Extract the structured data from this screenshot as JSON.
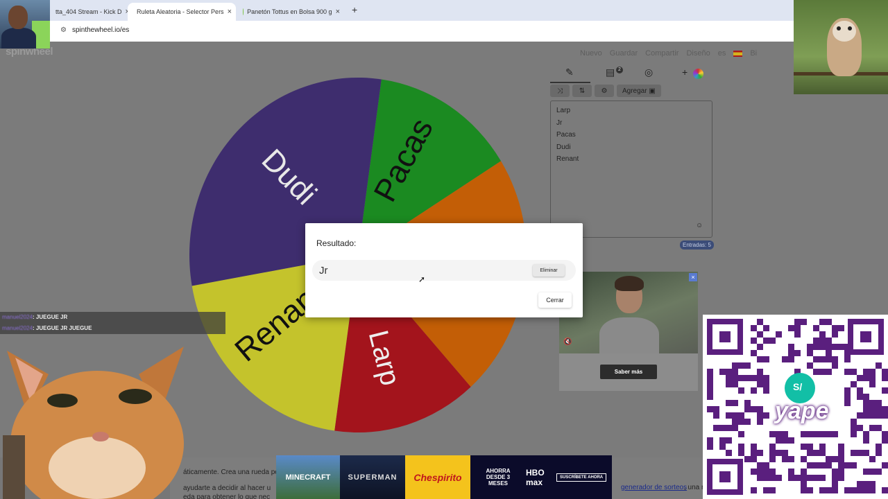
{
  "browser": {
    "tabs": [
      {
        "label": "tta_404 Stream - Kick D"
      },
      {
        "label": "Ruleta Aleatoria - Selector Pers"
      },
      {
        "label": "Panetón Tottus en Bolsa 900 g"
      }
    ],
    "new_tab": "+",
    "tab_close": "×",
    "url": "spinthewheel.io/es"
  },
  "site": {
    "logo": "spinwheel",
    "nav": [
      "Nuevo",
      "Guardar",
      "Compartir",
      "Diseño",
      "es",
      "Bi"
    ]
  },
  "wheel": {
    "segments": [
      {
        "label": "Pacas",
        "color": "#1b8a21"
      },
      {
        "label": "Jr",
        "color": "#c35e06"
      },
      {
        "label": "Larp",
        "color": "#a3141c"
      },
      {
        "label": "Renant",
        "color": "#c4c32c"
      },
      {
        "label": "Dudi",
        "color": "#3e2d6e"
      }
    ]
  },
  "editor": {
    "tabs": [
      "edit-icon",
      "results-icon",
      "hide-icon",
      "add-color-icon"
    ],
    "results_badge": "2",
    "add_label": "Agregar",
    "entries": [
      "Larp",
      "Jr",
      "Pacas",
      "Dudi",
      "Renant"
    ],
    "entry_count": "Entradas: 5"
  },
  "modal": {
    "title": "Resultado:",
    "result": "Jr",
    "delete_label": "Eliminar",
    "close_label": "Cerrar"
  },
  "ad": {
    "cta": "Saber más",
    "close": "×"
  },
  "chat": [
    {
      "user": "manuel2024",
      "text": ": JUEGUE JR"
    },
    {
      "user": "manuel2024",
      "text": ": JUEGUE JR JUEGUE"
    }
  ],
  "bottom": {
    "line1": "áticamente. Crea una rueda pe",
    "line2": "ayudarte a decidir al hacer u",
    "line3": "eda para obtener lo que nec",
    "link": "generador de sorteos",
    "after_link": ", una ru"
  },
  "banners": [
    "MINECRAFT",
    "SUPERMAN",
    "Chespirito",
    "AHORRA DESDE 3 MESES",
    "HBO max",
    "SUSCRÍBETE AHORA"
  ],
  "qr": {
    "brand": "yape",
    "currency": "S/"
  }
}
